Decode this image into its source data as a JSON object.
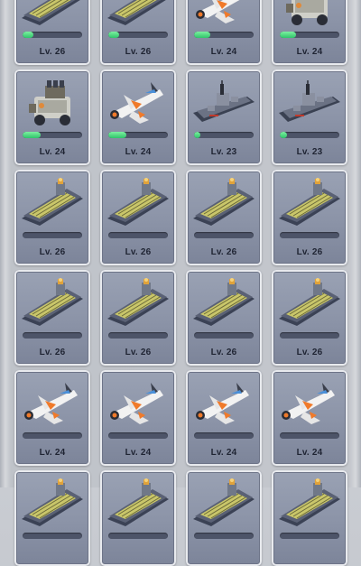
{
  "units": [
    {
      "type": "carrier",
      "level": "Lv. 26",
      "progress": 0.18
    },
    {
      "type": "carrier",
      "level": "Lv. 26",
      "progress": 0.18
    },
    {
      "type": "jet",
      "level": "Lv. 24",
      "progress": 0.28
    },
    {
      "type": "mech",
      "level": "Lv. 24",
      "progress": 0.28
    },
    {
      "type": "mech",
      "level": "Lv. 24",
      "progress": 0.3
    },
    {
      "type": "jet",
      "level": "Lv. 24",
      "progress": 0.3
    },
    {
      "type": "destroyer",
      "level": "Lv. 23",
      "progress": 0.1
    },
    {
      "type": "destroyer",
      "level": "Lv. 23",
      "progress": 0.12
    },
    {
      "type": "carrier",
      "level": "Lv. 26",
      "progress": 0
    },
    {
      "type": "carrier",
      "level": "Lv. 26",
      "progress": 0
    },
    {
      "type": "carrier",
      "level": "Lv. 26",
      "progress": 0
    },
    {
      "type": "carrier",
      "level": "Lv. 26",
      "progress": 0
    },
    {
      "type": "carrier",
      "level": "Lv. 26",
      "progress": 0
    },
    {
      "type": "carrier",
      "level": "Lv. 26",
      "progress": 0
    },
    {
      "type": "carrier",
      "level": "Lv. 26",
      "progress": 0
    },
    {
      "type": "carrier",
      "level": "Lv. 26",
      "progress": 0
    },
    {
      "type": "jet",
      "level": "Lv. 24",
      "progress": 0
    },
    {
      "type": "jet",
      "level": "Lv. 24",
      "progress": 0
    },
    {
      "type": "jet",
      "level": "Lv. 24",
      "progress": 0
    },
    {
      "type": "jet",
      "level": "Lv. 24",
      "progress": 0
    },
    {
      "type": "carrier",
      "level": "",
      "progress": 0
    },
    {
      "type": "carrier",
      "level": "",
      "progress": 0
    },
    {
      "type": "carrier",
      "level": "",
      "progress": 0
    },
    {
      "type": "carrier",
      "level": "",
      "progress": 0
    }
  ],
  "colors": {
    "progress_fill": "#2fc46a",
    "card_bg": "#8b93a7",
    "level_text": "#1f2433"
  }
}
